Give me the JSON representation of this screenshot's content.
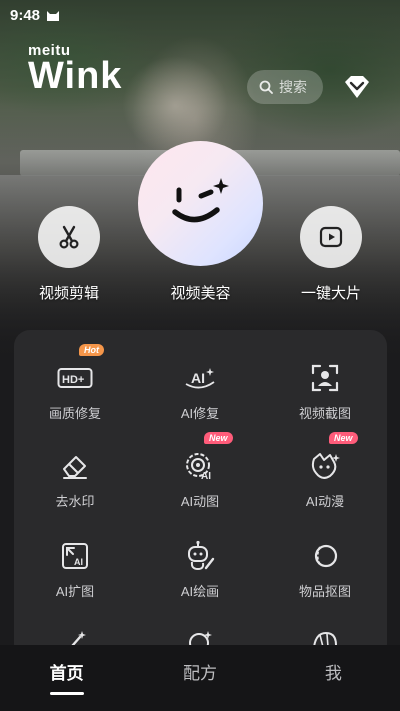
{
  "status_bar": {
    "time": "9:48"
  },
  "brand": {
    "meitu": "meitu",
    "wink": "Wink"
  },
  "search": {
    "placeholder": "搜索"
  },
  "hero_actions": [
    {
      "label": "视频剪辑",
      "icon": "scissors-icon"
    },
    {
      "label": "视频美容",
      "icon": "wink-face-icon"
    },
    {
      "label": "一键大片",
      "icon": "play-square-icon"
    }
  ],
  "tools": [
    {
      "label": "画质修复",
      "icon": "hd-plus-icon",
      "badge": "Hot"
    },
    {
      "label": "AI修复",
      "icon": "ai-sparkle-icon"
    },
    {
      "label": "视频截图",
      "icon": "portrait-frame-icon"
    },
    {
      "label": "去水印",
      "icon": "eraser-icon"
    },
    {
      "label": "AI动图",
      "icon": "ai-target-icon",
      "badge": "New"
    },
    {
      "label": "AI动漫",
      "icon": "anime-character-icon",
      "badge": "New"
    },
    {
      "label": "AI扩图",
      "icon": "ai-expand-icon"
    },
    {
      "label": "AI绘画",
      "icon": "robot-paint-icon"
    },
    {
      "label": "物品抠图",
      "icon": "object-cutout-icon"
    }
  ],
  "nav": [
    {
      "label": "首页",
      "active": true
    },
    {
      "label": "配方",
      "active": false
    },
    {
      "label": "我",
      "active": false
    }
  ],
  "colors": {
    "hot_badge": "#f5964a",
    "new_badge": "#ff5c7a",
    "panel": "#2a2a2c"
  }
}
